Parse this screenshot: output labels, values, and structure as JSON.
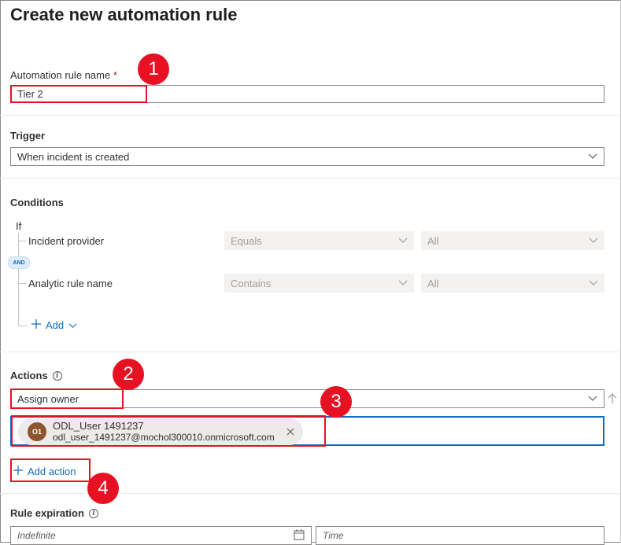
{
  "page": {
    "title": "Create new automation rule"
  },
  "rule_name": {
    "label": "Automation rule name",
    "required_mark": "*",
    "value": "Tier 2"
  },
  "trigger": {
    "label": "Trigger",
    "value": "When incident is created"
  },
  "conditions": {
    "label": "Conditions",
    "if_label": "If",
    "and_label": "AND",
    "rows": [
      {
        "field": "Incident provider",
        "operator": "Equals",
        "value": "All"
      },
      {
        "field": "Analytic rule name",
        "operator": "Contains",
        "value": "All"
      }
    ],
    "add_label": "Add"
  },
  "actions": {
    "label": "Actions",
    "action_value": "Assign owner",
    "owner": {
      "initials": "O1",
      "name": "ODL_User 1491237",
      "email": "odl_user_1491237@mochol300010.onmicrosoft.com"
    },
    "add_action_label": "Add action"
  },
  "expiration": {
    "label": "Rule expiration",
    "date_placeholder": "Indefinite",
    "time_placeholder": "Time"
  },
  "callouts": [
    "1",
    "2",
    "3",
    "4"
  ],
  "colors": {
    "accent": "#0f6cbd",
    "callout": "#e81123"
  }
}
